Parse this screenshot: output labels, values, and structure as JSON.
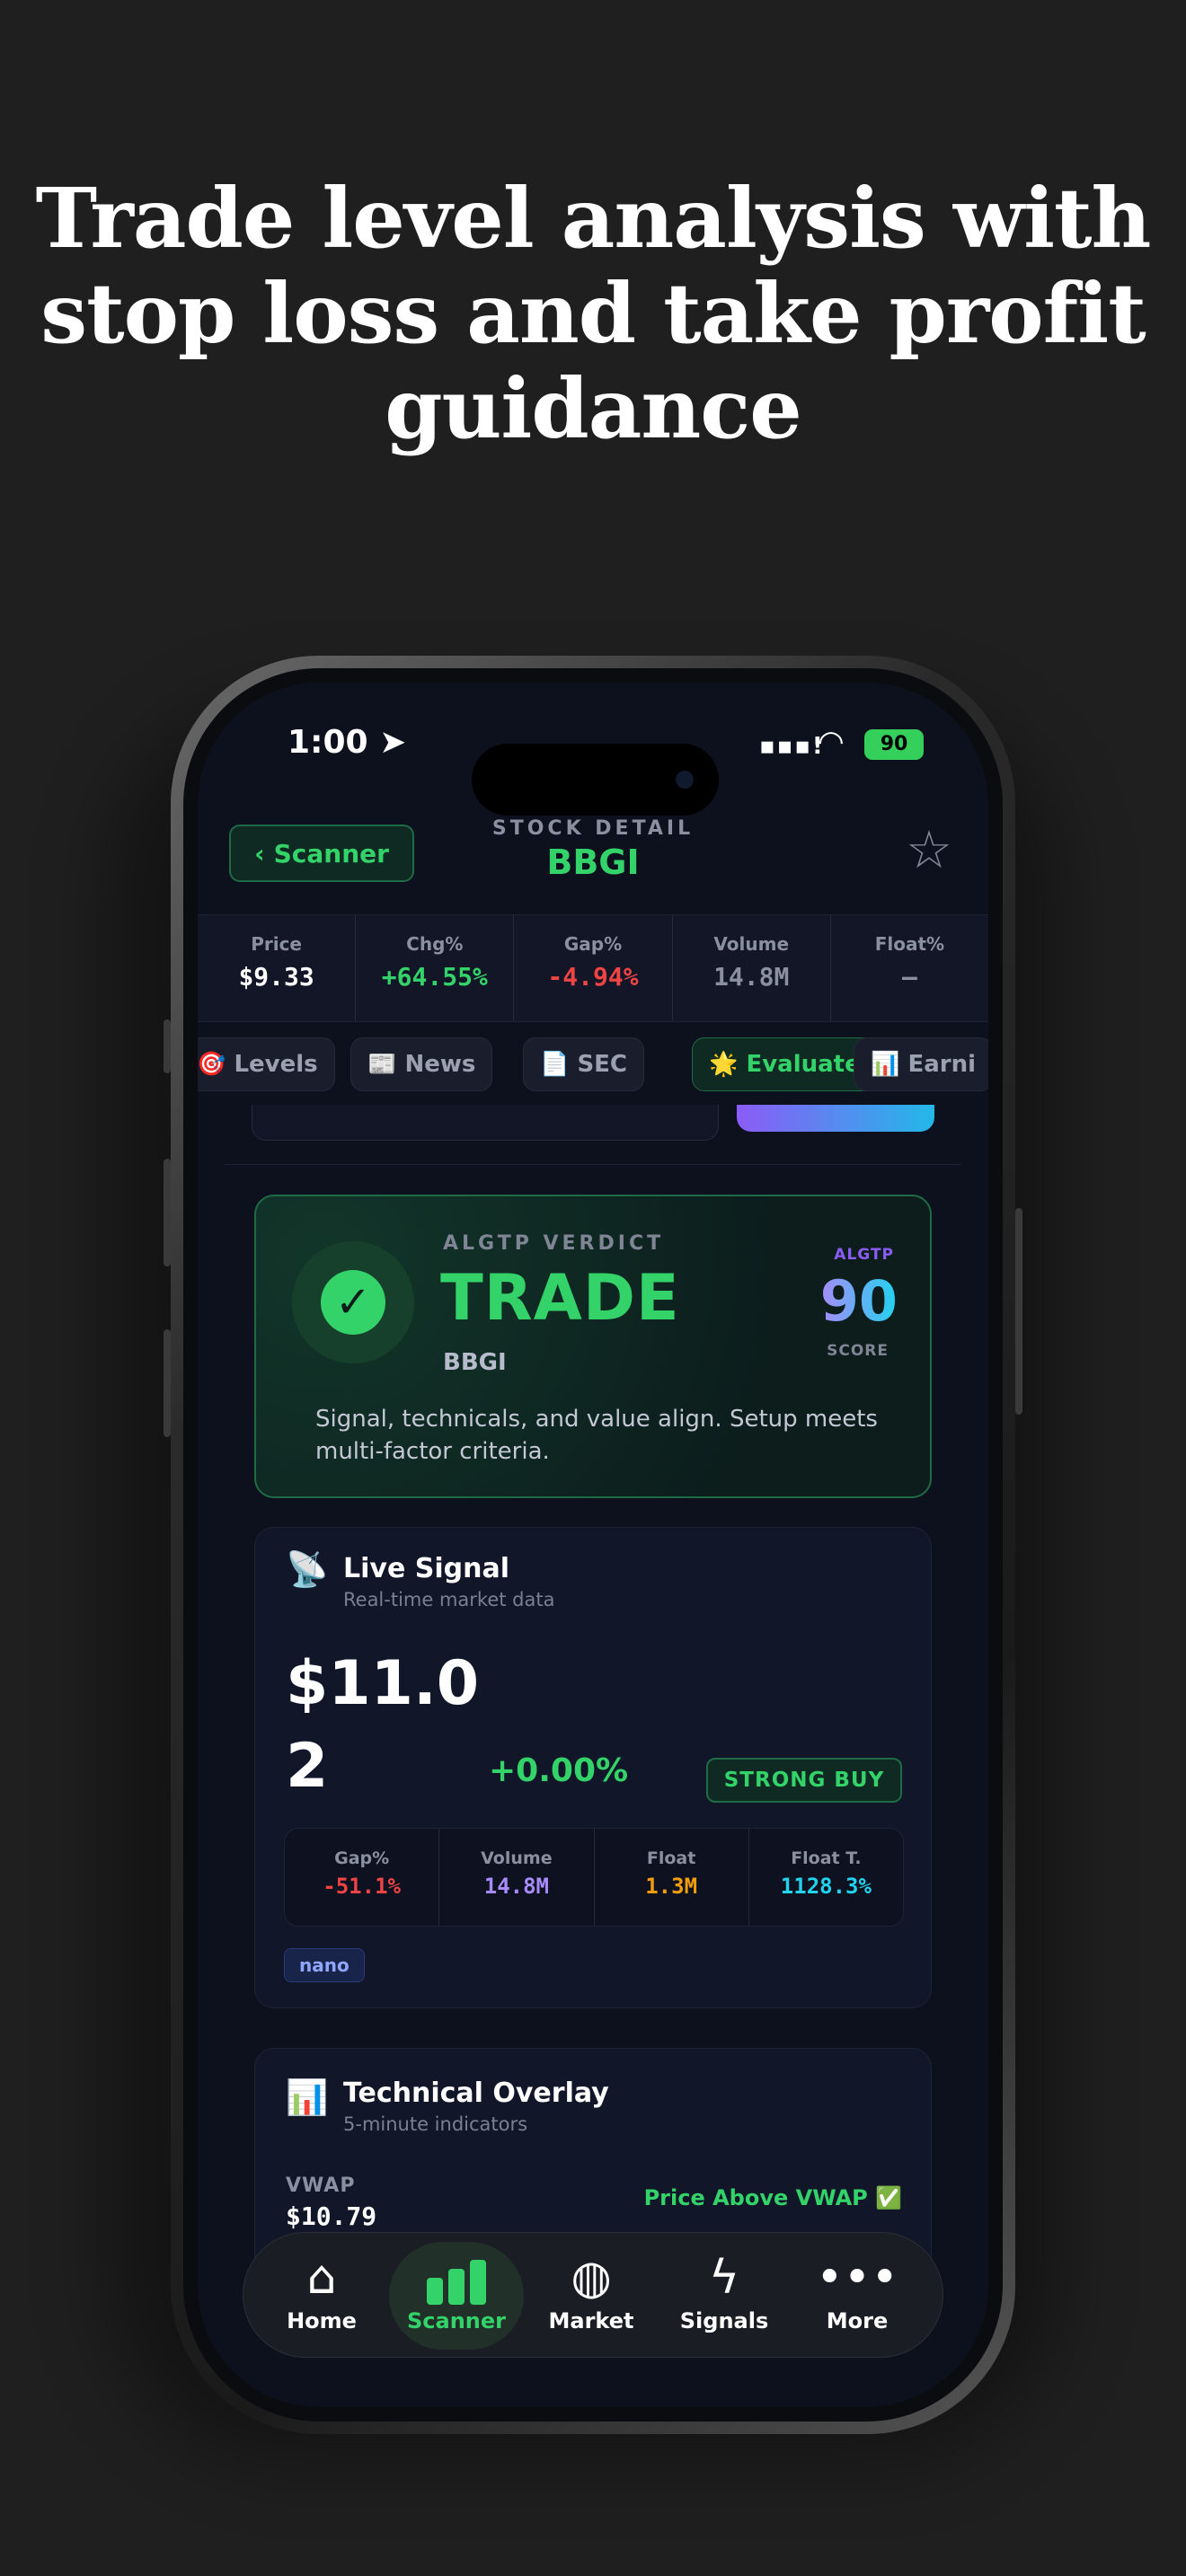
{
  "headline": "Trade level analysis with stop loss and take profit guidance",
  "status": {
    "time": "1:00",
    "battery": "90"
  },
  "header": {
    "back_label": "Scanner",
    "subtitle": "STOCK DETAIL",
    "title": "BBGI"
  },
  "quotes": [
    {
      "label": "Price",
      "value": "$9.33",
      "color": "#ffffff"
    },
    {
      "label": "Chg%",
      "value": "+64.55%",
      "color": "#34d36a"
    },
    {
      "label": "Gap%",
      "value": "-4.94%",
      "color": "#ef4444"
    },
    {
      "label": "Volume",
      "value": "14.8M",
      "color": "#8a90a0"
    },
    {
      "label": "Float%",
      "value": "–",
      "color": "#8a90a0"
    }
  ],
  "tabs": [
    {
      "icon": "🎯",
      "label": "Levels"
    },
    {
      "icon": "📰",
      "label": "News"
    },
    {
      "icon": "📄",
      "label": "SEC"
    },
    {
      "icon": "🌟",
      "label": "Evaluate"
    },
    {
      "icon": "📊",
      "label": "Earni"
    }
  ],
  "verdict": {
    "label": "ALGTP VERDICT",
    "value": "TRADE",
    "ticker": "BBGI",
    "score_label_top": "ALGTP",
    "score": "90",
    "score_label_bottom": "SCORE",
    "description": "Signal, technicals, and value align. Setup meets multi-factor criteria."
  },
  "live_signal": {
    "title": "Live Signal",
    "subtitle": "Real-time market data",
    "price": "$11.02",
    "change": "+0.00%",
    "rating": "STRONG BUY",
    "stats": [
      {
        "label": "Gap%",
        "value": "-51.1%",
        "color": "#ef4444"
      },
      {
        "label": "Volume",
        "value": "14.8M",
        "color": "#a78bfa"
      },
      {
        "label": "Float",
        "value": "1.3M",
        "color": "#f59e0b"
      },
      {
        "label": "Float T.",
        "value": "1128.3%",
        "color": "#22d3ee"
      }
    ],
    "tag": "nano"
  },
  "technical": {
    "title": "Technical Overlay",
    "subtitle": "5-minute indicators",
    "vwap_label": "VWAP",
    "vwap_value": "$10.79",
    "vwap_status": "Price Above VWAP ✅"
  },
  "tabbar": [
    {
      "label": "Home",
      "icon": "home-icon"
    },
    {
      "label": "Scanner",
      "icon": "bar-chart-icon"
    },
    {
      "label": "Market",
      "icon": "globe-icon"
    },
    {
      "label": "Signals",
      "icon": "lightning-icon"
    },
    {
      "label": "More",
      "icon": "more-icon"
    }
  ]
}
